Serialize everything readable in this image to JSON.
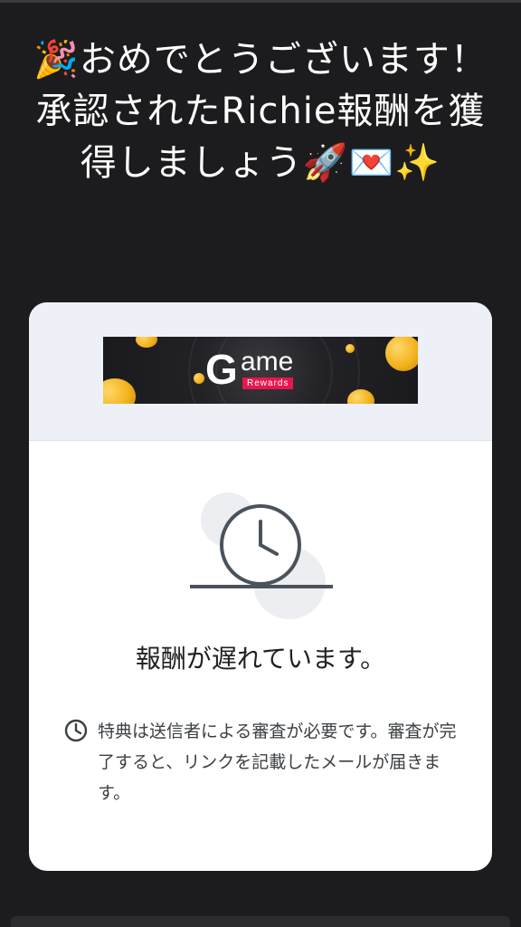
{
  "headline": {
    "text": "🎉おめでとうございます！承認されたRichie報酬を獲得しましょう🚀💌✨"
  },
  "banner": {
    "logo_initial": "G",
    "logo_rest": "ame",
    "logo_sub": "Rewards",
    "accent_color": "#e8154e"
  },
  "status": {
    "icon": "clock-icon",
    "title": "報酬が遅れています。"
  },
  "note": {
    "icon": "clock-icon",
    "text": "特典は送信者による審査が必要です。審査が完了すると、リンクを記載したメールが届きます。"
  }
}
